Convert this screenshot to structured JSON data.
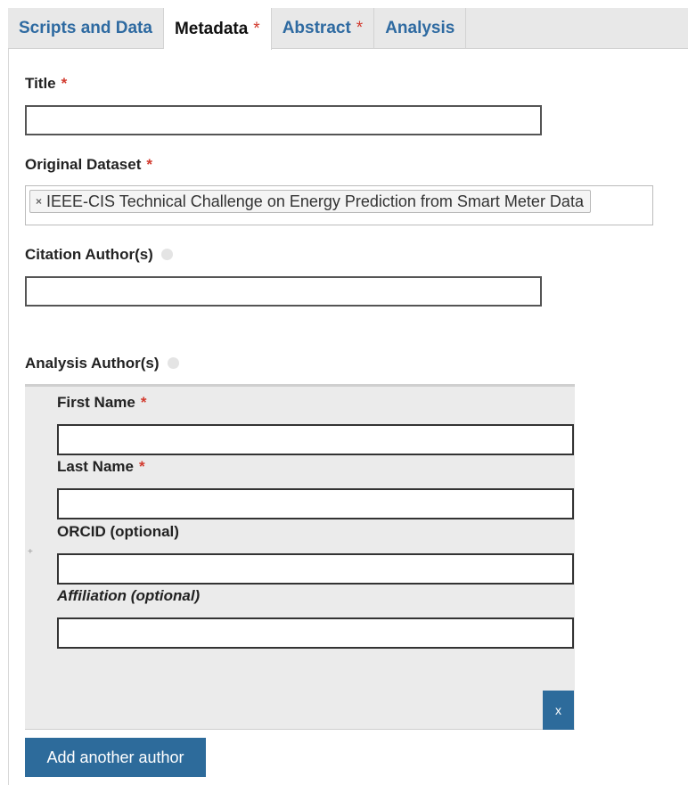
{
  "tabs": [
    {
      "label": "Scripts and Data",
      "required": ""
    },
    {
      "label": "Metadata",
      "required": "*"
    },
    {
      "label": "Abstract",
      "required": "*"
    },
    {
      "label": "Analysis",
      "required": ""
    }
  ],
  "active_tab": "Metadata",
  "form": {
    "title": {
      "label": "Title",
      "required": "*",
      "value": ""
    },
    "original_dataset": {
      "label": "Original Dataset",
      "required": "*",
      "selected": [
        "IEEE-CIS Technical Challenge on Energy Prediction from Smart Meter Data"
      ],
      "remove_glyph": "×"
    },
    "citation_authors": {
      "label": "Citation Author(s)",
      "value": ""
    },
    "analysis_authors": {
      "label": "Analysis Author(s)",
      "first_name": {
        "label": "First Name",
        "required": "*",
        "value": ""
      },
      "last_name": {
        "label": "Last Name",
        "required": "*",
        "value": ""
      },
      "orcid": {
        "label": "ORCID (optional)",
        "value": ""
      },
      "affiliation": {
        "label": "Affiliation (optional)",
        "value": ""
      },
      "remove_label": "x",
      "drag_handle": "+"
    },
    "add_author_label": "Add another author"
  },
  "colors": {
    "accent": "#2d6b9b",
    "link": "#2e6aa1",
    "required": "#d23a2e",
    "panel_bg": "#ebebeb"
  }
}
